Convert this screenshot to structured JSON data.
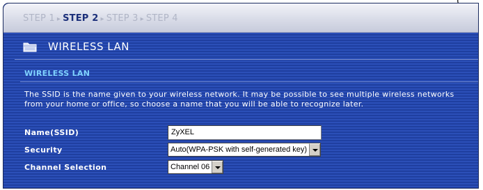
{
  "corner_text": "(",
  "steps": [
    {
      "label": "STEP 1",
      "active": false
    },
    {
      "label": "STEP 2",
      "active": true
    },
    {
      "label": "STEP 3",
      "active": false
    },
    {
      "label": "STEP 4",
      "active": false
    }
  ],
  "step_separator": "▸",
  "page": {
    "title": "WIRELESS LAN",
    "icon": "folder-icon"
  },
  "section": {
    "heading": "WIRELESS LAN",
    "description": "The SSID is the name given to your wireless network. It may be possible to see multiple wireless networks from your home or office, so choose a name that you will be able to recognize later."
  },
  "form": {
    "name_label": "Name(SSID)",
    "name_value": "ZyXEL",
    "security_label": "Security",
    "security_value": "Auto(WPA-PSK with self-generated key)",
    "channel_label": "Channel Selection",
    "channel_value": "Channel 06"
  },
  "colors": {
    "panel": "#1f3fa0",
    "heading": "#7fd3ff",
    "active_step": "#1b2f7a"
  }
}
